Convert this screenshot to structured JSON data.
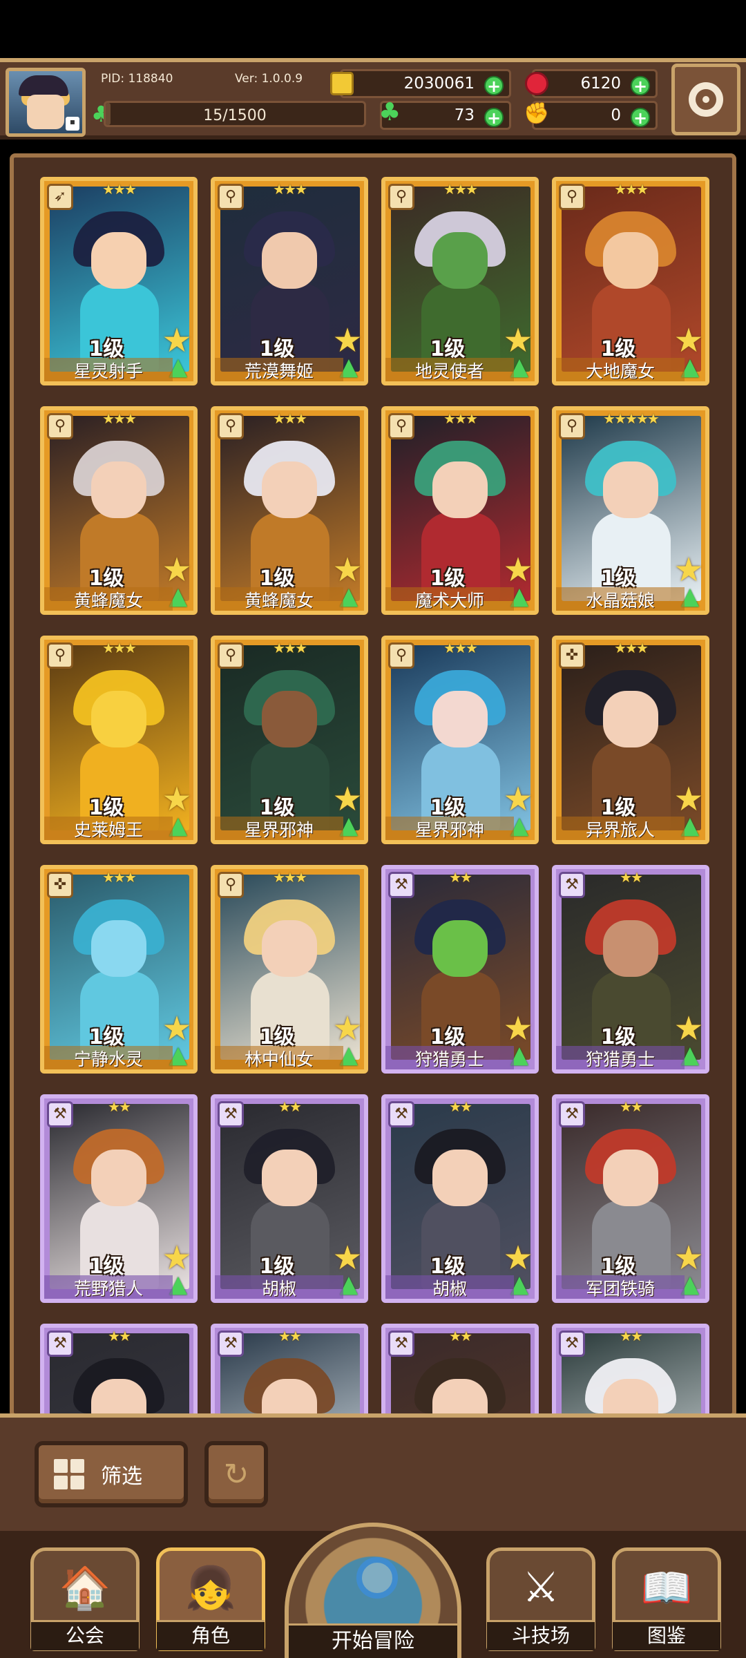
{
  "header": {
    "pid": "PID: 118840",
    "version": "Ver: 1.0.0.9",
    "xp": "15/1500",
    "xp_progress": 0.01,
    "gold": "2030061",
    "gems": "6120",
    "clover": "73",
    "gear": "0"
  },
  "cards": [
    {
      "name": "星灵射手",
      "level": "1级",
      "stars": "★★★",
      "rarity": "gold",
      "icon": "bow-icon",
      "palette": [
        "#1c3e62",
        "#3bc5d8",
        "#f6d0b0",
        "#1b2140"
      ]
    },
    {
      "name": "荒漠舞姬",
      "level": "1级",
      "stars": "★★★",
      "rarity": "gold",
      "icon": "sword-icon",
      "palette": [
        "#1f2d3c",
        "#2d2a44",
        "#f0c9ad",
        "#2a2a4a"
      ]
    },
    {
      "name": "地灵使者",
      "level": "1级",
      "stars": "★★★",
      "rarity": "gold",
      "icon": "sword-icon",
      "palette": [
        "#3c2a24",
        "#3f6b2e",
        "#59a04a",
        "#d6d0e0"
      ]
    },
    {
      "name": "大地魔女",
      "level": "1级",
      "stars": "★★★",
      "rarity": "gold",
      "icon": "sword-icon",
      "palette": [
        "#6a2a1a",
        "#b0482a",
        "#f3c8a0",
        "#d8842e"
      ]
    },
    {
      "name": "黄蜂魔女",
      "level": "1级",
      "stars": "★★★",
      "rarity": "gold",
      "icon": "sword-icon",
      "palette": [
        "#2a1f24",
        "#c07a28",
        "#f3d0b8",
        "#d8d0d0"
      ]
    },
    {
      "name": "黄蜂魔女",
      "level": "1级",
      "stars": "★★★",
      "rarity": "gold",
      "icon": "sword-icon",
      "palette": [
        "#2a2024",
        "#c07a28",
        "#f3d0b8",
        "#e8e8f0"
      ]
    },
    {
      "name": "魔术大师",
      "level": "1级",
      "stars": "★★★",
      "rarity": "gold",
      "icon": "sword-icon",
      "palette": [
        "#1f2028",
        "#b02a30",
        "#f3d0b8",
        "#3aa07a"
      ]
    },
    {
      "name": "水晶菇娘",
      "level": "1级",
      "stars": "★★★★★",
      "rarity": "gold",
      "icon": "sword-icon",
      "palette": [
        "#1f3a4a",
        "#e8f0f4",
        "#f3d0b8",
        "#3fc0c8"
      ]
    },
    {
      "name": "史莱姆王",
      "level": "1级",
      "stars": "★★★",
      "rarity": "gold",
      "icon": "sword-icon",
      "palette": [
        "#5a3a12",
        "#f0b020",
        "#f8d040",
        "#f2c020"
      ]
    },
    {
      "name": "星界邪神",
      "level": "1级",
      "stars": "★★★",
      "rarity": "gold",
      "icon": "sword-icon",
      "palette": [
        "#1a2a24",
        "#2a4a3a",
        "#8a5a3a",
        "#2f6a50"
      ]
    },
    {
      "name": "星界邪神",
      "level": "1级",
      "stars": "★★★",
      "rarity": "gold",
      "icon": "sword-icon",
      "palette": [
        "#1a3a5a",
        "#80c0e0",
        "#f3d8d0",
        "#3aa8d8"
      ]
    },
    {
      "name": "异界旅人",
      "level": "1级",
      "stars": "★★★",
      "rarity": "gold",
      "icon": "shield-icon",
      "palette": [
        "#2a1f1a",
        "#7a4a28",
        "#f3d0b8",
        "#20202a"
      ]
    },
    {
      "name": "宁静水灵",
      "level": "1级",
      "stars": "★★★",
      "rarity": "gold",
      "icon": "shield-icon",
      "palette": [
        "#2a5a6a",
        "#60c8e0",
        "#8ad8f0",
        "#3ab0d0"
      ]
    },
    {
      "name": "林中仙女",
      "level": "1级",
      "stars": "★★★",
      "rarity": "gold",
      "icon": "sword-icon",
      "palette": [
        "#2a4a5a",
        "#e8e0d0",
        "#f3d0b8",
        "#f0d080"
      ]
    },
    {
      "name": "狩猎勇士",
      "level": "1级",
      "stars": "★★",
      "rarity": "purple",
      "icon": "axe-icon",
      "palette": [
        "#2a2a3a",
        "#7a4a28",
        "#6ac048",
        "#20284a"
      ]
    },
    {
      "name": "狩猎勇士",
      "level": "1级",
      "stars": "★★",
      "rarity": "purple",
      "icon": "axe-icon",
      "palette": [
        "#2a2a2a",
        "#4a4a30",
        "#c89070",
        "#c03a2a"
      ]
    },
    {
      "name": "荒野猎人",
      "level": "1级",
      "stars": "★★",
      "rarity": "purple",
      "icon": "axe-icon",
      "palette": [
        "#2a2a30",
        "#e8e0e0",
        "#f3d0b8",
        "#c06a2a"
      ]
    },
    {
      "name": "胡椒",
      "level": "1级",
      "stars": "★★",
      "rarity": "purple",
      "icon": "axe-icon",
      "palette": [
        "#2a2a30",
        "#5a5a60",
        "#f3d0b8",
        "#20202a"
      ]
    },
    {
      "name": "胡椒",
      "level": "1级",
      "stars": "★★",
      "rarity": "purple",
      "icon": "axe-icon",
      "palette": [
        "#2a3a4a",
        "#505060",
        "#f3d0b8",
        "#1a1a22"
      ]
    },
    {
      "name": "军团铁骑",
      "level": "1级",
      "stars": "★★",
      "rarity": "purple",
      "icon": "axe-icon",
      "palette": [
        "#3a2a2a",
        "#8a8a90",
        "#f3d0b8",
        "#c03a2a"
      ]
    },
    {
      "name": "",
      "level": "",
      "stars": "★★",
      "rarity": "purple",
      "icon": "axe-icon",
      "palette": [
        "#2a2a30",
        "#3a3a44",
        "#f3d0b8",
        "#1a1a22"
      ]
    },
    {
      "name": "",
      "level": "",
      "stars": "★★",
      "rarity": "purple",
      "icon": "axe-icon",
      "palette": [
        "#2a3a4a",
        "#e8f0f4",
        "#f3d0b8",
        "#7a4a28"
      ]
    },
    {
      "name": "",
      "level": "",
      "stars": "★★",
      "rarity": "purple",
      "icon": "axe-icon",
      "palette": [
        "#3a2a2a",
        "#5a3a28",
        "#f3d0b8",
        "#3a2a20"
      ]
    },
    {
      "name": "",
      "level": "",
      "stars": "★★",
      "rarity": "purple",
      "icon": "axe-icon",
      "palette": [
        "#2a3a3a",
        "#e8eef0",
        "#f3d0b8",
        "#f0f0f4"
      ]
    }
  ],
  "filter": {
    "label": "筛选"
  },
  "nav": {
    "guild": "公会",
    "character": "角色",
    "adventure": "开始冒险",
    "arena": "斗技场",
    "codex": "图鉴"
  }
}
